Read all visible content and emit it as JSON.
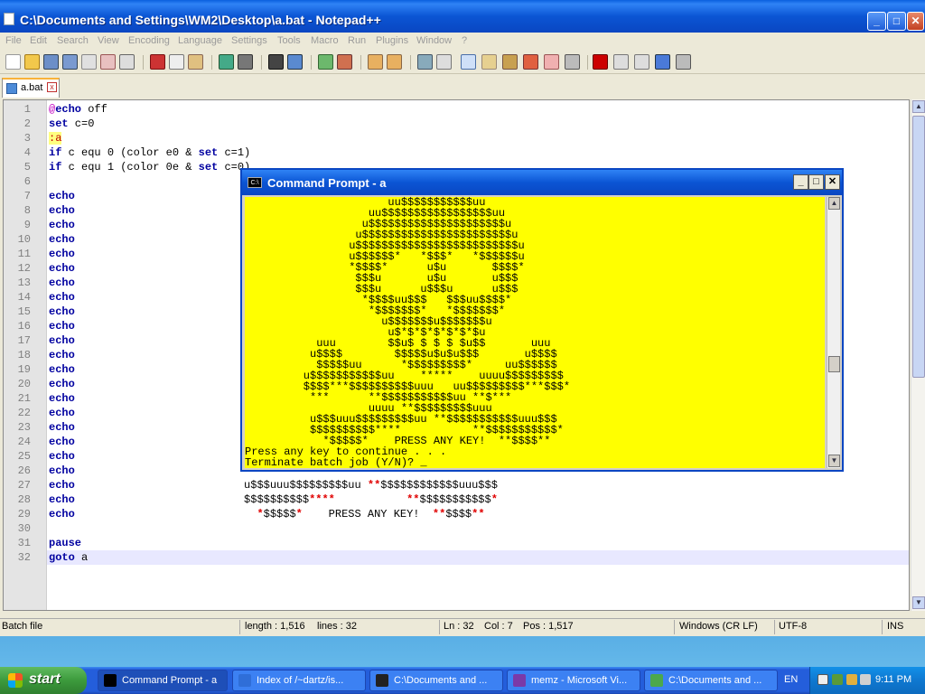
{
  "window": {
    "title": "C:\\Documents and Settings\\WM2\\Desktop\\a.bat - Notepad++",
    "minimize": "_",
    "maximize": "□",
    "close": "✕"
  },
  "menu": [
    "File",
    "Edit",
    "Search",
    "View",
    "Encoding",
    "Language",
    "Settings",
    "Tools",
    "Macro",
    "Run",
    "Plugins",
    "Window",
    "?"
  ],
  "tab": {
    "label": "a.bat",
    "close": "x"
  },
  "editor": {
    "current_line": 32,
    "lines": [
      {
        "n": "1",
        "html": "<span class='at'>@</span><span class='kw'>echo</span> off"
      },
      {
        "n": "2",
        "html": "<span class='kw'>set</span> c=0"
      },
      {
        "n": "3",
        "html": "<span class='lab'>:a</span>"
      },
      {
        "n": "4",
        "html": "<span class='kw'>if</span> c equ 0 (color e0 &amp; <span class='kw'>set</span> c=1)"
      },
      {
        "n": "5",
        "html": "<span class='kw'>if</span> c equ 1 (color 0e &amp; <span class='kw'>set</span> c=0)"
      },
      {
        "n": "6",
        "html": ""
      },
      {
        "n": "7",
        "html": "<span class='kw'>echo</span>"
      },
      {
        "n": "8",
        "html": "<span class='kw'>echo</span>"
      },
      {
        "n": "9",
        "html": "<span class='kw'>echo</span>"
      },
      {
        "n": "10",
        "html": "<span class='kw'>echo</span>"
      },
      {
        "n": "11",
        "html": "<span class='kw'>echo</span>"
      },
      {
        "n": "12",
        "html": "<span class='kw'>echo</span>"
      },
      {
        "n": "13",
        "html": "<span class='kw'>echo</span>"
      },
      {
        "n": "14",
        "html": "<span class='kw'>echo</span>"
      },
      {
        "n": "15",
        "html": "<span class='kw'>echo</span>"
      },
      {
        "n": "16",
        "html": "<span class='kw'>echo</span>"
      },
      {
        "n": "17",
        "html": "<span class='kw'>echo</span>"
      },
      {
        "n": "18",
        "html": "<span class='kw'>echo</span>"
      },
      {
        "n": "19",
        "html": "<span class='kw'>echo</span>"
      },
      {
        "n": "20",
        "html": "<span class='kw'>echo</span>"
      },
      {
        "n": "21",
        "html": "<span class='kw'>echo</span>"
      },
      {
        "n": "22",
        "html": "<span class='kw'>echo</span>"
      },
      {
        "n": "23",
        "html": "<span class='kw'>echo</span>                          u$"
      },
      {
        "n": "24",
        "html": "<span class='kw'>echo</span>                          $$"
      },
      {
        "n": "25",
        "html": "<span class='kw'>echo</span>                           <span class='red'>*</span>"
      },
      {
        "n": "26",
        "html": "<span class='kw'>echo</span>"
      },
      {
        "n": "27",
        "html": "<span class='kw'>echo</span>                          u$$$uuu$$$$$$$$$uu <span class='red'>**</span>$$$$$$$$$$$$uuu$$$"
      },
      {
        "n": "28",
        "html": "<span class='kw'>echo</span>                          $$$$$$$$$$<span class='red'>****</span>           <span class='red'>**</span>$$$$$$$$$$$<span class='red'>*</span>"
      },
      {
        "n": "29",
        "html": "<span class='kw'>echo</span>                            <span class='red'>*</span>$$$$$<span class='red'>*</span>    PRESS ANY KEY!  <span class='red'>**</span>$$$$<span class='red'>**</span>"
      },
      {
        "n": "30",
        "html": ""
      },
      {
        "n": "31",
        "html": "<span class='kw'>pause</span>"
      },
      {
        "n": "32",
        "html": "<span class='kw'>goto</span> a"
      }
    ]
  },
  "status": {
    "type": "Batch file",
    "length": "length : 1,516",
    "lines": "lines : 32",
    "ln": "Ln : 32",
    "col": "Col : 7",
    "pos": "Pos : 1,517",
    "eol": "Windows (CR LF)",
    "encoding": "UTF-8",
    "mode": "INS"
  },
  "cmd": {
    "title": "Command Prompt - a",
    "icon_text": "C:\\",
    "lines": [
      "                      uu$$$$$$$$$$$uu",
      "                   uu$$$$$$$$$$$$$$$$$uu",
      "                  u$$$$$$$$$$$$$$$$$$$$$u",
      "                 u$$$$$$$$$$$$$$$$$$$$$$$u",
      "                u$$$$$$$$$$$$$$$$$$$$$$$$$u",
      "                u$$$$$$*   *$$$*   *$$$$$$u",
      "                *$$$$*      u$u       $$$$*",
      "                 $$$u       u$u       u$$$",
      "                 $$$u      u$$$u      u$$$",
      "                  *$$$$uu$$$   $$$uu$$$$*",
      "                   *$$$$$$$*   *$$$$$$$*",
      "                     u$$$$$$$u$$$$$$$u",
      "                      u$*$*$*$*$*$*$u",
      "           uuu        $$u$ $ $ $ $u$$       uuu",
      "          u$$$$        $$$$$u$u$u$$$       u$$$$",
      "           $$$$$uu      *$$$$$$$$$*     uu$$$$$$",
      "         u$$$$$$$$$$$uu    *****    uuuu$$$$$$$$$",
      "         $$$$***$$$$$$$$$$uuu   uu$$$$$$$$$***$$$*",
      "          ***      **$$$$$$$$$$$uu **$***",
      "                   uuuu **$$$$$$$$$uuu",
      "          u$$$uuu$$$$$$$$$uu **$$$$$$$$$$$uuu$$$",
      "          $$$$$$$$$$****           **$$$$$$$$$$$*",
      "            *$$$$$*    PRESS ANY KEY!  **$$$$**",
      "Press any key to continue . . .",
      "Terminate batch job (Y/N)? _"
    ]
  },
  "taskbar": {
    "start": "start",
    "tasks": [
      {
        "label": "Command Prompt - a",
        "color": "#000000",
        "active": true
      },
      {
        "label": "Index of /~dartz/is...",
        "color": "#2f6ed8",
        "active": false
      },
      {
        "label": "C:\\Documents and ...",
        "color": "#222222",
        "active": false
      },
      {
        "label": "memz - Microsoft Vi...",
        "color": "#7a3aa8",
        "active": false
      },
      {
        "label": "C:\\Documents and ...",
        "color": "#4ca84c",
        "active": false
      }
    ],
    "lang": "EN",
    "clock": "9:11 PM"
  }
}
